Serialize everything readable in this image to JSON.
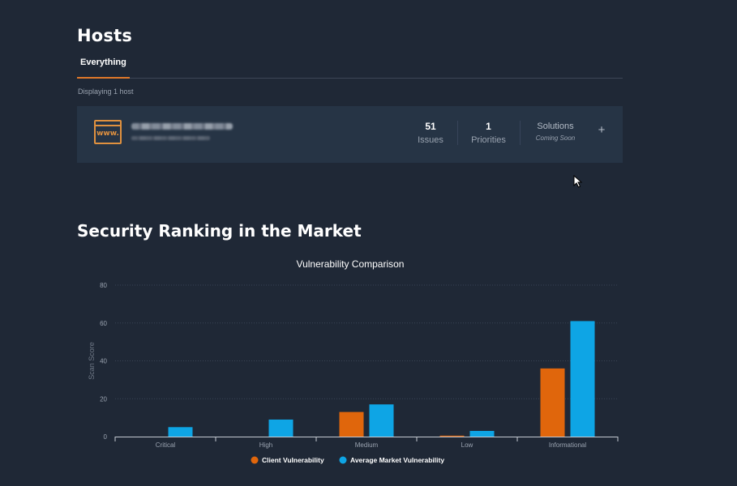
{
  "page": {
    "title": "Hosts"
  },
  "tabs": [
    {
      "label": "Everything",
      "active": true
    }
  ],
  "hosts_summary": "Displaying 1 host",
  "host": {
    "icon": "www-icon",
    "icon_text": "www.",
    "issues": {
      "value": "51",
      "label": "Issues"
    },
    "priorities": {
      "value": "1",
      "label": "Priorities"
    },
    "solutions": {
      "label": "Solutions",
      "note": "Coming Soon"
    },
    "expand": "+"
  },
  "section": {
    "title": "Security Ranking in the Market"
  },
  "colors": {
    "client": "#e0660c",
    "market": "#0ea5e5",
    "accent": "#e0782a",
    "background": "#1f2836",
    "card": "#263445"
  },
  "chart_data": {
    "type": "bar",
    "title": "Vulnerability Comparison",
    "ylabel": "Scan Score",
    "xlabel": "",
    "ylim": [
      0,
      80
    ],
    "yticks": [
      0,
      20,
      40,
      60,
      80
    ],
    "grid": true,
    "legend_position": "bottom",
    "categories": [
      "Critical",
      "High",
      "Medium",
      "Low",
      "Informational"
    ],
    "series": [
      {
        "name": "Client Vulnerability",
        "color": "#e0660c",
        "values": [
          0,
          0,
          13,
          0.5,
          36
        ]
      },
      {
        "name": "Average Market Vulnerability",
        "color": "#0ea5e5",
        "values": [
          5,
          9,
          17,
          3,
          61
        ]
      }
    ]
  }
}
